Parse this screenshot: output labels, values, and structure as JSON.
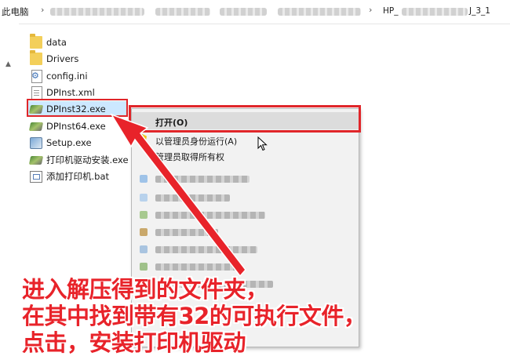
{
  "breadcrumb": {
    "root": "此电脑",
    "separator": "›",
    "last_prefix": "HP_",
    "last_suffix": "J_3_1"
  },
  "files": [
    {
      "name": "data",
      "icon": "folder-icon"
    },
    {
      "name": "Drivers",
      "icon": "folder-icon"
    },
    {
      "name": "config.ini",
      "icon": "config-file-icon"
    },
    {
      "name": "DPInst.xml",
      "icon": "document-icon"
    },
    {
      "name": "DPInst32.exe",
      "icon": "installer-exe-icon",
      "selected": true
    },
    {
      "name": "DPInst64.exe",
      "icon": "installer-exe-icon"
    },
    {
      "name": "Setup.exe",
      "icon": "setup-exe-icon"
    },
    {
      "name": "打印机驱动安装.exe",
      "icon": "installer-exe-icon"
    },
    {
      "name": "添加打印机.bat",
      "icon": "batch-file-icon"
    }
  ],
  "context_menu": {
    "open": "打开(O)",
    "run_as_admin": "以管理员身份运行(A)",
    "take_ownership": "管理员取得所有权"
  },
  "caption": {
    "line1": "进入解压得到的文件夹，",
    "line2": "在其中找到带有32的可执行文件，",
    "line3": "点击，安装打印机驱动"
  },
  "colors": {
    "highlight_red": "#e0262a",
    "caption_red": "#e8232a",
    "selection_blue": "#cce8ff"
  }
}
